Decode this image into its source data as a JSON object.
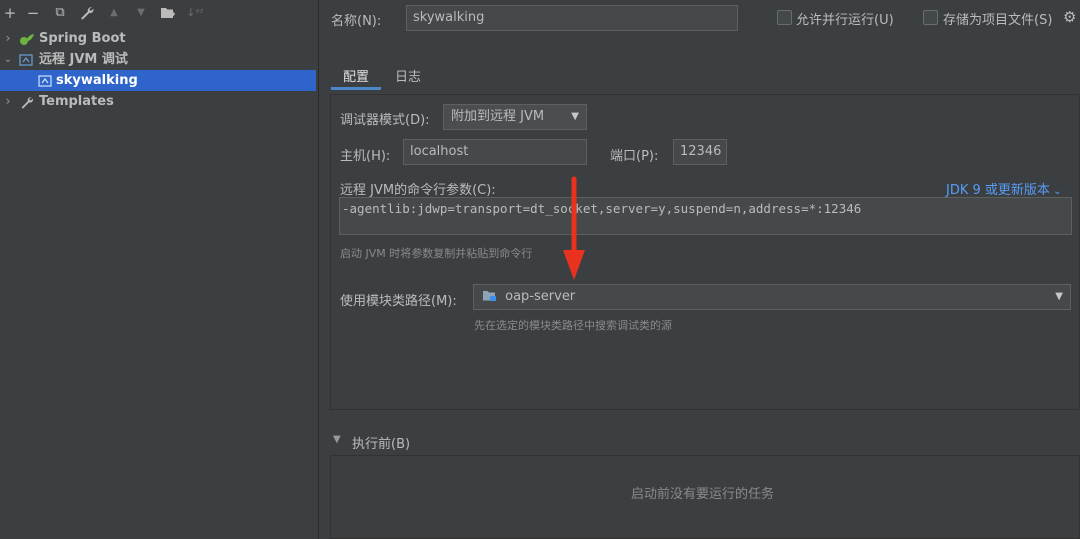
{
  "toolbar": {
    "add": "+",
    "remove": "−",
    "copy": "⧉",
    "edit": "🔧",
    "up": "▲",
    "down": "▼",
    "folder": "📁",
    "sort": "↓ᵃᶻ"
  },
  "tree": {
    "items": [
      {
        "label": "Spring Boot",
        "icon": "spring-leaf-icon"
      },
      {
        "label": "远程 JVM 调试",
        "icon": "remote-debug-icon"
      },
      {
        "label": "skywalking",
        "icon": "remote-debug-icon"
      },
      {
        "label": "Templates",
        "icon": "wrench-icon"
      }
    ]
  },
  "form": {
    "name_label": "名称(N):",
    "name_value": "skywalking",
    "allow_parallel": "允许并行运行(U)",
    "store_as_file": "存储为项目文件(S)",
    "tabs": [
      "配置",
      "日志"
    ],
    "debugger_mode_label": "调试器模式(D):",
    "debugger_mode_value": "附加到远程 JVM",
    "host_label": "主机(H):",
    "host_value": "localhost",
    "port_label": "端口(P):",
    "port_value": "12346",
    "cmdline_label": "远程 JVM的命令行参数(C):",
    "jdk_link": "JDK 9 或更新版本",
    "cmdline_value": "-agentlib:jdwp=transport=dt_socket,server=y,suspend=n,address=*:12346",
    "cmdline_hint": "启动 JVM 时将参数复制并粘贴到命令行",
    "module_label": "使用模块类路径(M):",
    "module_value": "oap-server",
    "module_hint": "先在选定的模块类路径中搜索调试类的源",
    "before_launch_label": "执行前(B)",
    "before_launch_empty": "启动前没有要运行的任务"
  },
  "colors": {
    "background": "#3c3f41",
    "selection": "#2f65ca",
    "link": "#589df6",
    "arrow": "#e8321e"
  }
}
